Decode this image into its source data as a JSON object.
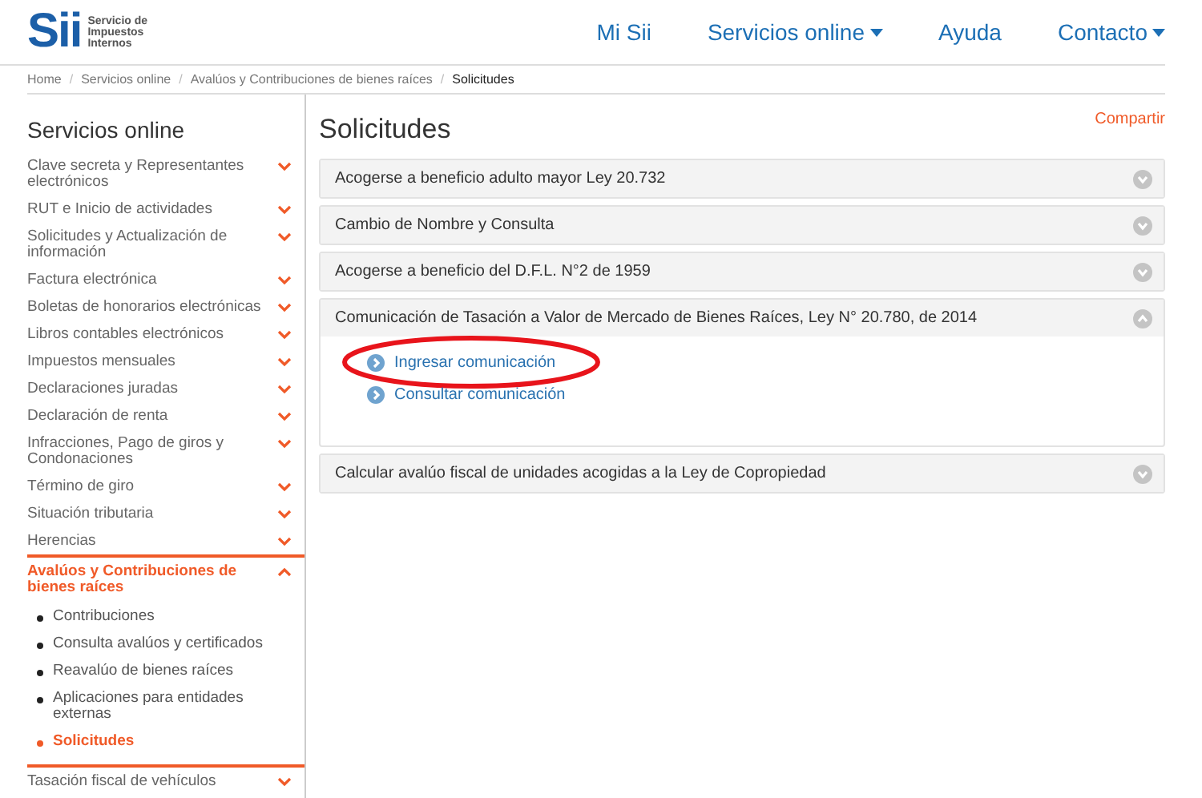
{
  "header": {
    "logo": "Sii",
    "logo_caption": [
      "Servicio de",
      "Impuestos",
      "Internos"
    ],
    "nav": [
      {
        "label": "Mi Sii",
        "dropdown": false
      },
      {
        "label": "Servicios online",
        "dropdown": true
      },
      {
        "label": "Ayuda",
        "dropdown": false
      },
      {
        "label": "Contacto",
        "dropdown": true
      }
    ]
  },
  "breadcrumb": [
    {
      "label": "Home",
      "current": false
    },
    {
      "separator": "/",
      "label": "Servicios online",
      "current": false
    },
    {
      "separator": "/",
      "label": "Avalúos y Contribuciones de bienes raíces",
      "current": false
    },
    {
      "separator": "/",
      "label": "Solicitudes",
      "current": true
    }
  ],
  "sidebar": {
    "title": "Servicios online",
    "items": [
      {
        "label": "Clave secreta y Representantes electrónicos",
        "expanded": false
      },
      {
        "label": "RUT e Inicio de actividades",
        "expanded": false
      },
      {
        "label": "Solicitudes y Actualización de información",
        "expanded": false
      },
      {
        "label": "Factura electrónica",
        "expanded": false
      },
      {
        "label": "Boletas de honorarios electrónicas",
        "expanded": false
      },
      {
        "label": "Libros contables electrónicos",
        "expanded": false
      },
      {
        "label": "Impuestos mensuales",
        "expanded": false
      },
      {
        "label": "Declaraciones juradas",
        "expanded": false
      },
      {
        "label": "Declaración de renta",
        "expanded": false
      },
      {
        "label": "Infracciones, Pago de giros y Condonaciones",
        "expanded": false
      },
      {
        "label": "Término de giro",
        "expanded": false
      },
      {
        "label": "Situación tributaria",
        "expanded": false
      },
      {
        "label": "Herencias",
        "expanded": false
      },
      {
        "label": "Avalúos y Contribuciones de bienes raíces",
        "expanded": true,
        "children": [
          {
            "label": "Contribuciones",
            "selected": false
          },
          {
            "label": "Consulta avalúos y certificados",
            "selected": false
          },
          {
            "label": "Reavalúo de bienes raíces",
            "selected": false
          },
          {
            "label": "Aplicaciones para entidades externas",
            "selected": false
          },
          {
            "label": "Solicitudes",
            "selected": true
          }
        ]
      },
      {
        "label": "Tasación fiscal de vehículos",
        "expanded": false
      }
    ]
  },
  "main": {
    "title": "Solicitudes",
    "share": "Compartir",
    "panels": [
      {
        "title": "Acogerse a beneficio adulto mayor Ley 20.732",
        "expanded": false
      },
      {
        "title": "Cambio de Nombre y Consulta",
        "expanded": false
      },
      {
        "title": "Acogerse a beneficio del D.F.L. N°2 de 1959",
        "expanded": false
      },
      {
        "title": "Comunicación de Tasación a Valor de Mercado de Bienes Raíces, Ley N° 20.780, de 2014",
        "expanded": true,
        "links": [
          {
            "label": "Ingresar comunicación",
            "circled": true
          },
          {
            "label": "Consultar comunicación",
            "circled": false
          }
        ]
      },
      {
        "title": "Calcular avalúo fiscal de unidades acogidas a la Ley de Copropiedad",
        "expanded": false
      }
    ]
  }
}
